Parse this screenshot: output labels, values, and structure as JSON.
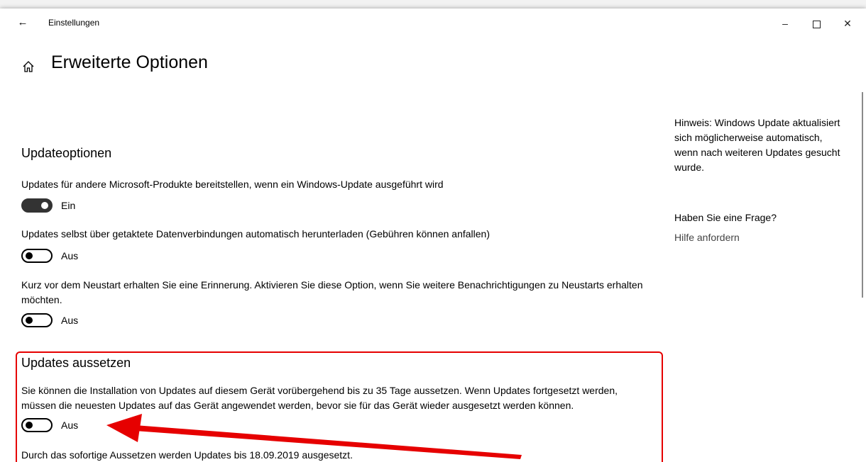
{
  "window": {
    "app_title": "Einstellungen",
    "back_icon": "←",
    "minimize_icon": "–",
    "close_icon": "✕"
  },
  "header": {
    "title": "Erweiterte Optionen"
  },
  "update_options": {
    "heading": "Updateoptionen",
    "items": [
      {
        "description": "Updates für andere Microsoft-Produkte bereitstellen, wenn ein Windows-Update ausgeführt wird",
        "state": "Ein",
        "on": true
      },
      {
        "description": "Updates selbst über getaktete Datenverbindungen automatisch herunterladen (Gebühren können anfallen)",
        "state": "Aus",
        "on": false
      },
      {
        "description": "Kurz vor dem Neustart erhalten Sie eine Erinnerung. Aktivieren Sie diese Option, wenn Sie weitere Benachrichtigungen zu Neustarts erhalten möchten.",
        "state": "Aus",
        "on": false
      }
    ]
  },
  "pause_updates": {
    "heading": "Updates aussetzen",
    "description": "Sie können die Installation von Updates auf diesem Gerät vorübergehend bis zu 35 Tage aussetzen. Wenn Updates fortgesetzt werden, müssen die neuesten Updates auf das Gerät angewendet werden, bevor sie für das Gerät wieder ausgesetzt werden können.",
    "state": "Aus",
    "on": false,
    "note": "Durch das sofortige Aussetzen werden Updates bis 18.09.2019 ausgesetzt."
  },
  "sidebar": {
    "hint": "Hinweis: Windows Update aktualisiert sich möglicherweise automatisch, wenn nach weiteren Updates gesucht wurde.",
    "question": "Haben Sie eine Frage?",
    "help_link": "Hilfe anfordern"
  },
  "annotation": {
    "color": "#e60000"
  }
}
